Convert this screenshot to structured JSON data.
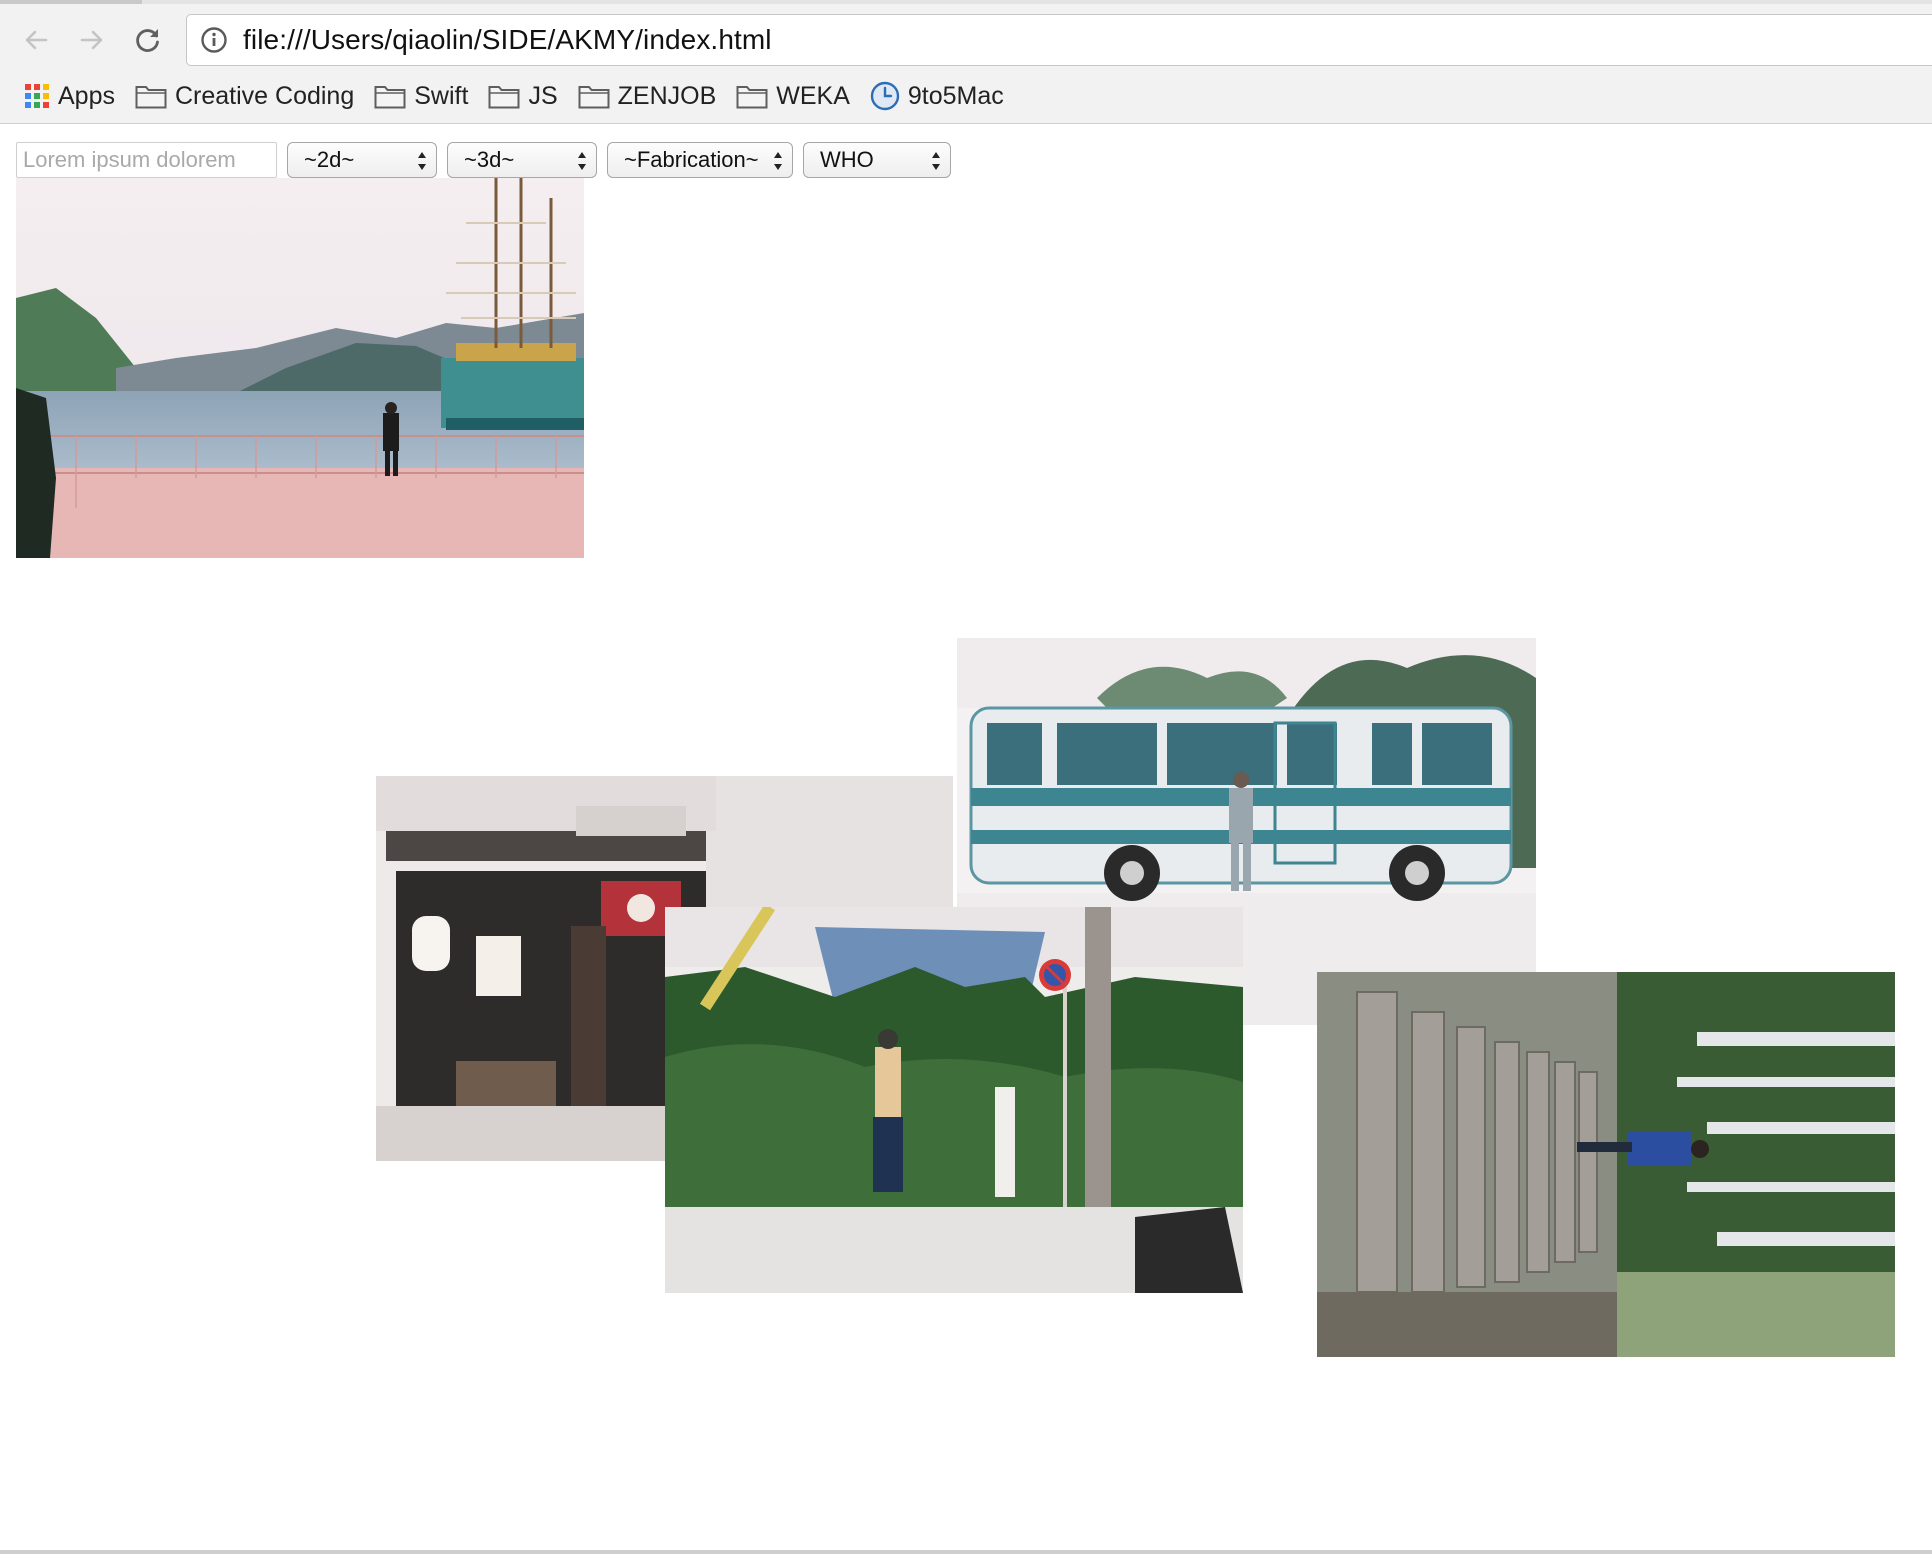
{
  "browser": {
    "url": "file:///Users/qiaolin/SIDE/AKMY/index.html",
    "icons": {
      "back": "arrow-left-icon",
      "forward": "arrow-right-icon",
      "reload": "reload-icon",
      "info": "info-icon"
    }
  },
  "bookmarks": [
    {
      "label": "Apps",
      "icon": "apps-grid-icon"
    },
    {
      "label": "Creative Coding",
      "icon": "folder-icon"
    },
    {
      "label": "Swift",
      "icon": "folder-icon"
    },
    {
      "label": "JS",
      "icon": "folder-icon"
    },
    {
      "label": "ZENJOB",
      "icon": "folder-icon"
    },
    {
      "label": "WEKA",
      "icon": "folder-icon"
    },
    {
      "label": "9to5Mac",
      "icon": "clock-icon"
    }
  ],
  "controls": {
    "search_placeholder": "Lorem ipsum dolorem",
    "select_2d": "~2d~",
    "select_3d": "~3d~",
    "select_fabrication": "~Fabrication~",
    "select_who": "WHO"
  },
  "photos": [
    {
      "name": "lake-pirate-ship-photo"
    },
    {
      "name": "blue-bus-photo"
    },
    {
      "name": "ramen-shop-photo"
    },
    {
      "name": "ivy-wall-street-photo"
    },
    {
      "name": "stone-lanterns-forest-photo"
    }
  ]
}
